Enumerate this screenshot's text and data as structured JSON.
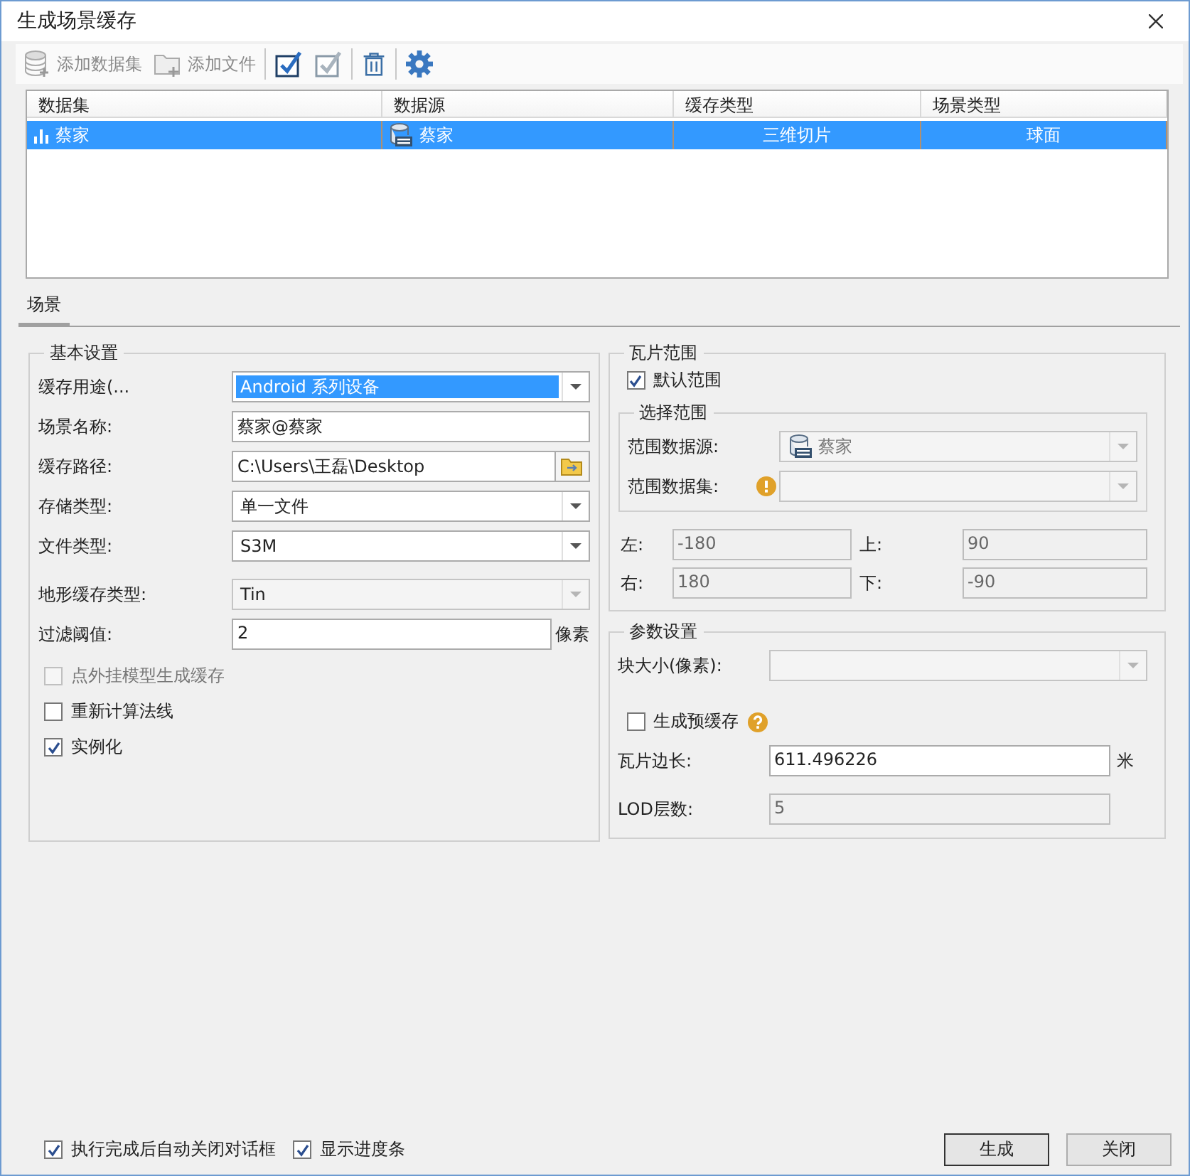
{
  "window": {
    "title": "生成场景缓存"
  },
  "toolbar": [
    {
      "kind": "add_dataset",
      "label": "添加数据集",
      "disabled": true
    },
    {
      "kind": "add_file",
      "label": "添加文件",
      "disabled": true
    },
    {
      "kind": "select_all",
      "disabled": false
    },
    {
      "kind": "select_invert",
      "disabled": true
    },
    {
      "kind": "delete",
      "disabled": false
    },
    {
      "kind": "settings",
      "disabled": false
    }
  ],
  "table": {
    "columns": [
      "数据集",
      "数据源",
      "缓存类型",
      "场景类型"
    ],
    "rows": [
      {
        "selected": true,
        "cells": [
          "蔡家",
          "蔡家",
          "三维切片",
          "球面"
        ]
      }
    ]
  },
  "tabs": [
    {
      "label": "场景",
      "selected": true
    }
  ],
  "basic": {
    "title": "基本设置",
    "fields": [
      {
        "kind": "combo",
        "label": "缓存用途(...",
        "value": "Android 系列设备",
        "highlighted": true,
        "disabled": false
      },
      {
        "kind": "text",
        "label": "场景名称:",
        "value": "蔡家@蔡家",
        "highlighted": false,
        "disabled": false
      },
      {
        "kind": "path",
        "label": "缓存路径:",
        "value": "C:\\Users\\王磊\\Desktop",
        "highlighted": false,
        "disabled": false
      },
      {
        "kind": "combo",
        "label": "存储类型:",
        "value": "单一文件",
        "highlighted": false,
        "disabled": false
      },
      {
        "kind": "combo",
        "label": "文件类型:",
        "value": "S3M",
        "highlighted": false,
        "disabled": false
      },
      {
        "kind": "combo",
        "label": "地形缓存类型:",
        "value": "Tin",
        "highlighted": false,
        "disabled": true
      },
      {
        "kind": "text",
        "label": "过滤阈值:",
        "value": "2",
        "unit": "像素",
        "highlighted": false,
        "disabled": false
      }
    ],
    "checks": [
      {
        "label": "点外挂模型生成缓存",
        "checked": false,
        "disabled": true
      },
      {
        "label": "重新计算法线",
        "checked": false,
        "disabled": false
      },
      {
        "label": "实例化",
        "checked": true,
        "disabled": false
      }
    ]
  },
  "tile_range": {
    "title": "瓦片范围",
    "default_range": {
      "label": "默认范围",
      "checked": true
    },
    "select_range": {
      "title": "选择范围",
      "source": {
        "label": "范围数据源:",
        "value": "蔡家"
      },
      "dataset": {
        "label": "范围数据集:",
        "warning": true
      }
    },
    "bounds": [
      {
        "label": "左:",
        "value": "-180"
      },
      {
        "label": "上:",
        "value": "90"
      },
      {
        "label": "右:",
        "value": "180"
      },
      {
        "label": "下:",
        "value": "-90"
      }
    ]
  },
  "params": {
    "title": "参数设置",
    "block_size": {
      "label": "块大小(像素):"
    },
    "precache": {
      "label": "生成预缓存",
      "checked": false,
      "help": true
    },
    "tile_length": {
      "label": "瓦片边长:",
      "value": "611.496226",
      "unit": "米"
    },
    "lod": {
      "label": "LOD层数:",
      "value": "5"
    }
  },
  "footer": {
    "options": [
      {
        "label": "执行完成后自动关闭对话框",
        "checked": true
      },
      {
        "label": "显示进度条",
        "checked": true
      }
    ],
    "buttons": [
      {
        "label": "生成",
        "default": true
      },
      {
        "label": "关闭",
        "default": false
      }
    ]
  }
}
